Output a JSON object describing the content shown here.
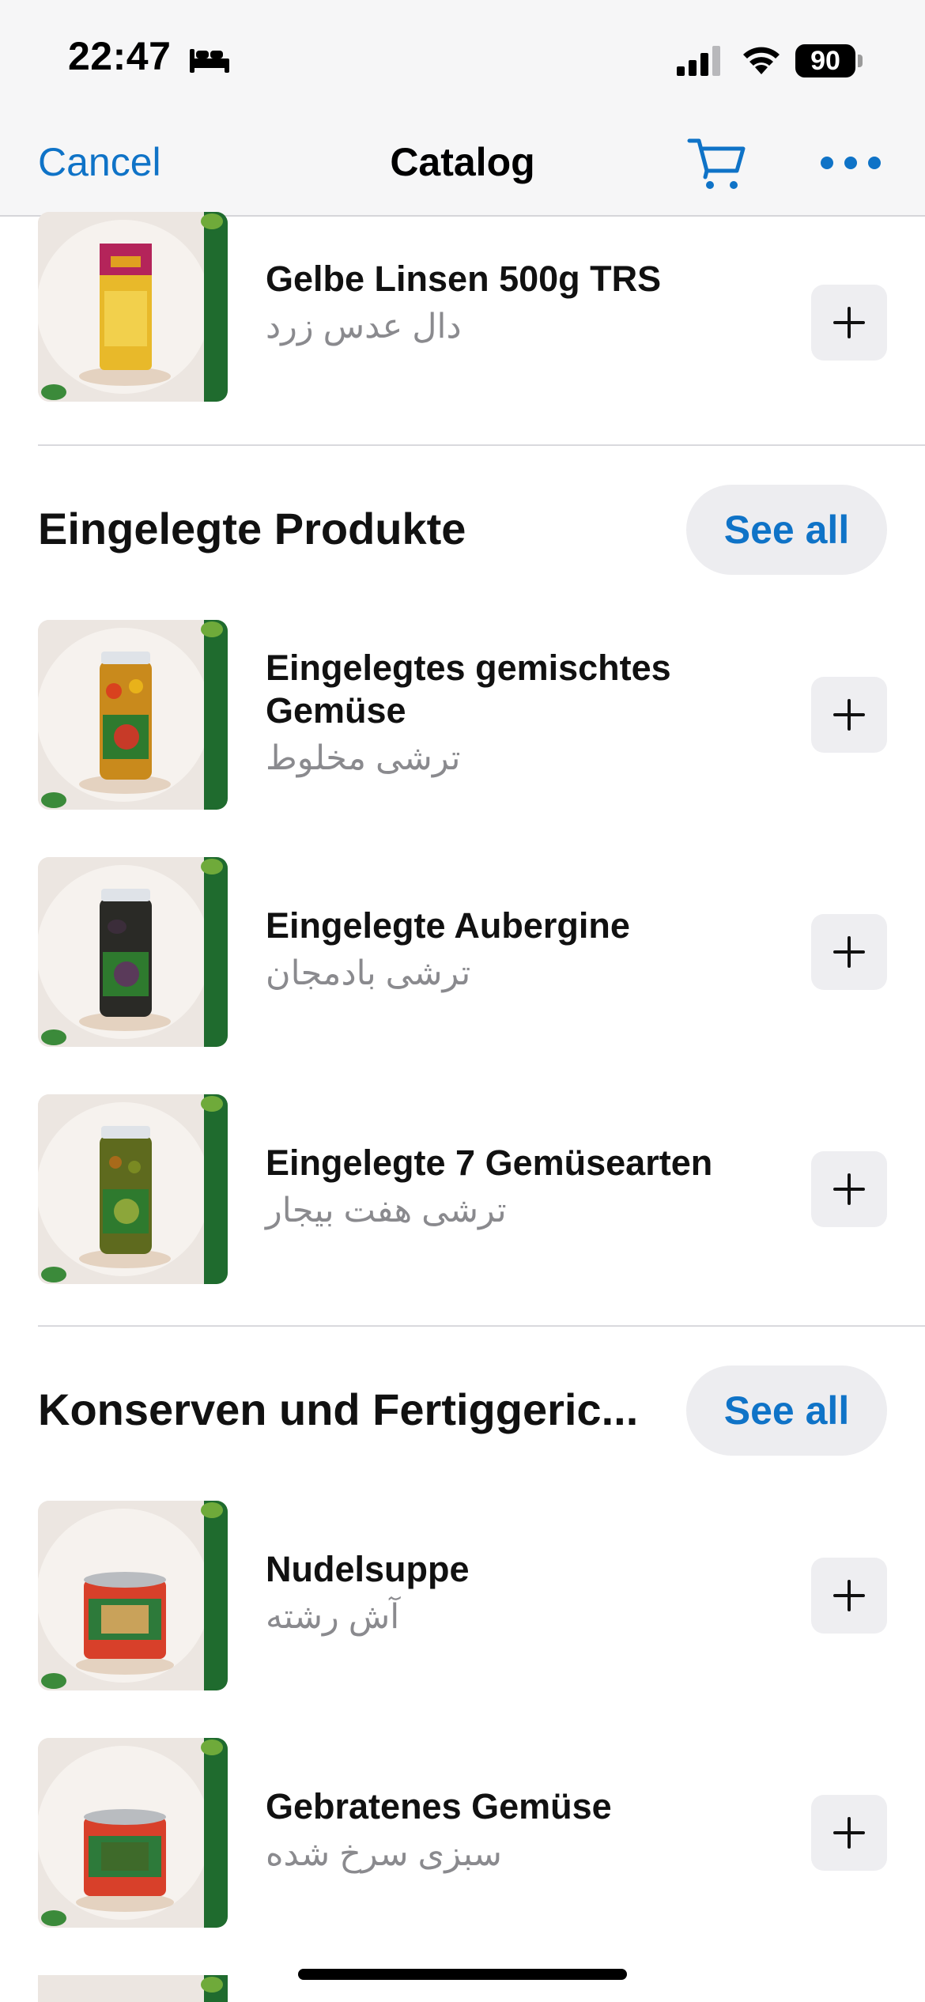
{
  "status_bar": {
    "time": "22:47",
    "battery": "90",
    "icons": [
      "bed-icon",
      "cellular-signal-icon",
      "wifi-icon",
      "battery-icon"
    ]
  },
  "nav": {
    "cancel_label": "Cancel",
    "title": "Catalog",
    "cart_icon": "cart-icon",
    "more_icon": "more-icon"
  },
  "colors": {
    "accent": "#0f73c7",
    "header_bg": "#f6f6f7",
    "secondary_text": "#8a8a8e",
    "button_bg": "#eeeef1"
  },
  "sections": [
    {
      "title": "",
      "products": [
        {
          "name": "Gelbe Linsen 500g TRS",
          "subtitle": "دال عدس زرد",
          "image": "lentils-package"
        }
      ]
    },
    {
      "title": "Eingelegte Produkte",
      "see_all_label": "See all",
      "products": [
        {
          "name": "Eingelegtes gemischtes Gemüse",
          "subtitle": "ترشی مخلوط",
          "image": "pickle-jar-mixed"
        },
        {
          "name": "Eingelegte Aubergine",
          "subtitle": "ترشی بادمجان",
          "image": "pickle-jar-eggplant"
        },
        {
          "name": "Eingelegte 7 Gemüsearten",
          "subtitle": "ترشی هفت بیجار",
          "image": "pickle-jar-seven"
        }
      ]
    },
    {
      "title": "Konserven und Fertiggeric...",
      "see_all_label": "See all",
      "products": [
        {
          "name": "Nudelsuppe",
          "subtitle": "آش رشته",
          "image": "can-noodle-soup"
        },
        {
          "name": "Gebratenes Gemüse",
          "subtitle": "سبزی سرخ شده",
          "image": "can-fried-vegetables"
        }
      ]
    }
  ]
}
